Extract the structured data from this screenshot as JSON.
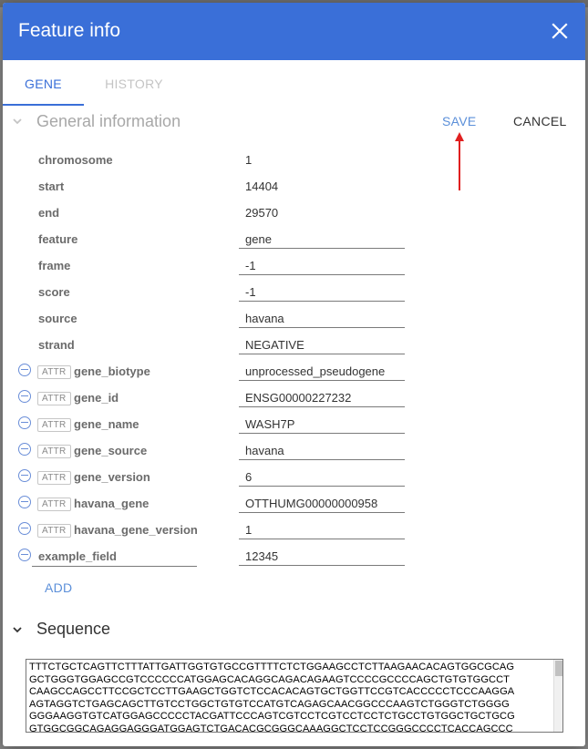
{
  "dialog": {
    "title": "Feature info",
    "close_icon": "close-icon"
  },
  "tabs": [
    {
      "label": "GENE",
      "active": true
    },
    {
      "label": "HISTORY",
      "active": false
    }
  ],
  "general": {
    "title": "General information",
    "save_label": "SAVE",
    "cancel_label": "CANCEL",
    "fields": [
      {
        "key": "chromosome",
        "value": "1"
      },
      {
        "key": "start",
        "value": "14404"
      },
      {
        "key": "end",
        "value": "29570"
      },
      {
        "key": "feature",
        "value": "gene"
      },
      {
        "key": "frame",
        "value": "-1"
      },
      {
        "key": "score",
        "value": "-1"
      },
      {
        "key": "source",
        "value": "havana"
      },
      {
        "key": "strand",
        "value": "NEGATIVE"
      }
    ],
    "attr_badge": "ATTR",
    "attributes": [
      {
        "key": "gene_biotype",
        "value": "unprocessed_pseudogene"
      },
      {
        "key": "gene_id",
        "value": "ENSG00000227232"
      },
      {
        "key": "gene_name",
        "value": "WASH7P"
      },
      {
        "key": "gene_source",
        "value": "havana"
      },
      {
        "key": "gene_version",
        "value": "6"
      },
      {
        "key": "havana_gene",
        "value": "OTTHUMG00000000958"
      },
      {
        "key": "havana_gene_version",
        "value": "1"
      }
    ],
    "new_field": {
      "key": "example_field",
      "value": "12345"
    },
    "add_label": "ADD"
  },
  "sequence": {
    "title": "Sequence",
    "lines": [
      "TTTCTGCTCAGTTCTTTATTGATTGGTGTGCCGTTTTCTCTGGAAGCCTCTTAAGAACACAGTGGCGCAG",
      "GCTGGGTGGAGCCGTCCCCCCATGGAGCACAGGCAGACAGAAGTCCCCGCCCCAGCTGTGTGGCCT",
      "CAAGCCAGCCTTCCGCTCCTTGAAGCTGGTCTCCACACAGTGCTGGTTCCGTCACCCCCTCCCAAGGA",
      "AGTAGGTCTGAGCAGCTTGTCCTGGCTGTGTCCATGTCAGAGCAACGGCCCAAGTCTGGGTCTGGGG",
      "GGGAAGGTGTCATGGAGCCCCCTACGATTCCCAGTCGTCCTCGTCCTCCTCTGCCTGTGGCTGCTGCG",
      "GTGGCGGCAGAGGAGGGATGGAGTCTGACACGCGGGCAAAGGCTCCTCCGGGCCCCTCACCAGCCC"
    ]
  },
  "colors": {
    "header_bg": "#3a6fd8",
    "accent": "#3a6fd8",
    "arrow": "#e02020"
  }
}
